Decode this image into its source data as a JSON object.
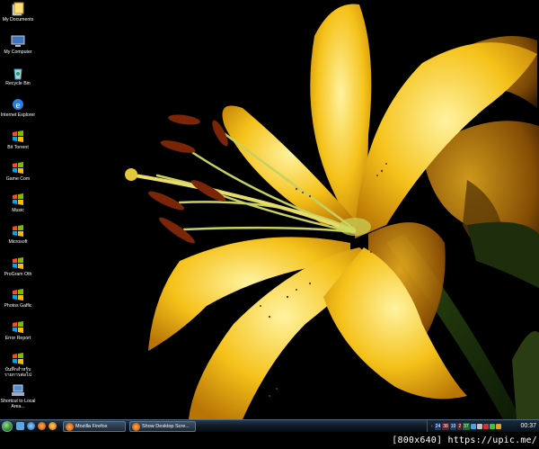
{
  "desktop_icons": [
    {
      "label": "My Documents",
      "icon": "my-documents-icon"
    },
    {
      "label": "My Computer",
      "icon": "my-computer-icon"
    },
    {
      "label": "Recycle Bin",
      "icon": "recycle-bin-icon"
    },
    {
      "label": "Internet Explorer",
      "icon": "internet-explorer-icon"
    },
    {
      "label": "Bit Torrent",
      "icon": "windows-shortcut-icon"
    },
    {
      "label": "Game Com",
      "icon": "windows-shortcut-icon"
    },
    {
      "label": "Music",
      "icon": "windows-shortcut-icon"
    },
    {
      "label": "Microsoft",
      "icon": "windows-shortcut-icon"
    },
    {
      "label": "ProGram Oth",
      "icon": "windows-shortcut-icon"
    },
    {
      "label": "Photos Gaffic",
      "icon": "windows-shortcut-icon"
    },
    {
      "label": "Error Report",
      "icon": "windows-shortcut-icon"
    },
    {
      "label": "บันทึกสำหรับรายการต่อไป",
      "icon": "windows-shortcut-icon"
    },
    {
      "label": "Shortcut to Local Area...",
      "icon": "network-connection-icon"
    }
  ],
  "taskbar": {
    "tasks": [
      {
        "label": "Mozilla Firefox",
        "icon": "firefox-icon"
      },
      {
        "label": "Show Desktop Scre...",
        "icon": "firefox-icon"
      }
    ],
    "tray_indicators": [
      "24",
      "38",
      "10",
      "2",
      "37"
    ],
    "clock": "00:37"
  },
  "watermark": "[800x640] https://upic.me/",
  "colors": {
    "petal": "#f5c21a",
    "taskbar": "#0e1a26",
    "start_orb": "#2e8b2e"
  }
}
